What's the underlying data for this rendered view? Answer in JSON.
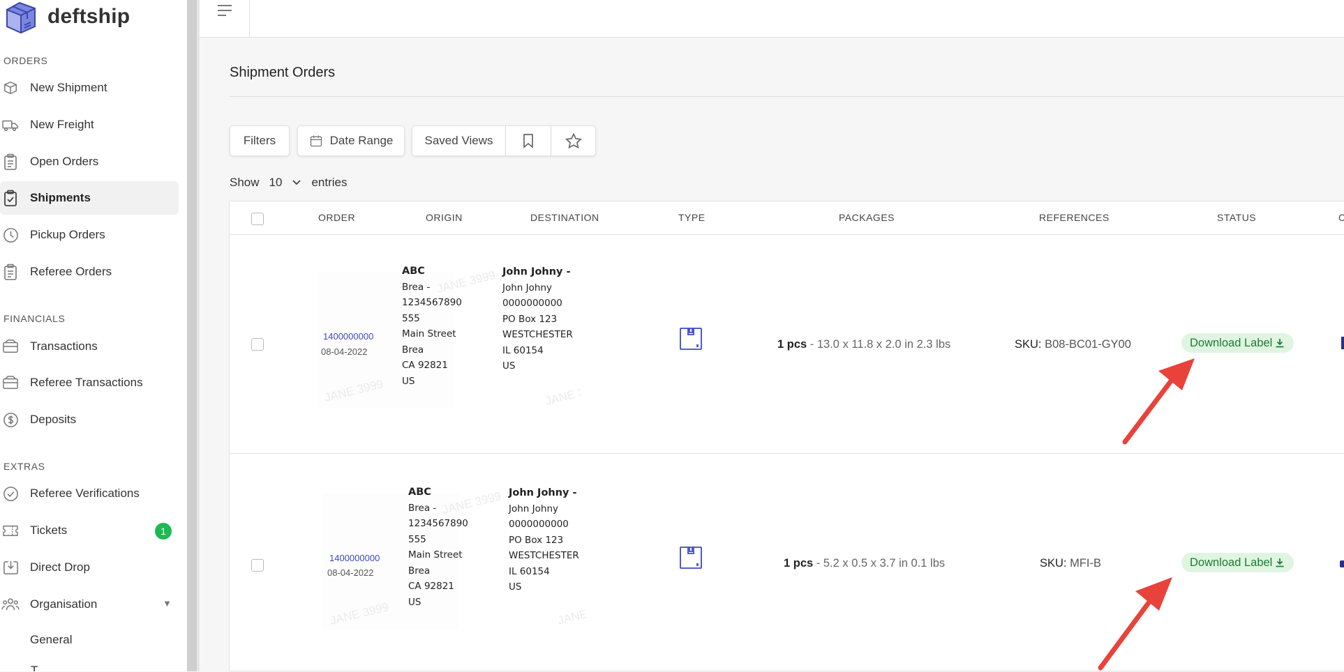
{
  "brand": {
    "name": "deftship"
  },
  "sidebar": {
    "sections": {
      "orders": "ORDERS",
      "financials": "FINANCIALS",
      "extras": "EXTRAS"
    },
    "items": [
      {
        "label": "New Shipment",
        "icon": "box-icon"
      },
      {
        "label": "New Freight",
        "icon": "truck-icon"
      },
      {
        "label": "Open Orders",
        "icon": "clipboard-icon"
      },
      {
        "label": "Shipments",
        "icon": "clipboard-check-icon",
        "active": true
      },
      {
        "label": "Pickup Orders",
        "icon": "clock-icon"
      },
      {
        "label": "Referee Orders",
        "icon": "clipboard-icon"
      },
      {
        "label": "Transactions",
        "icon": "wallet-icon"
      },
      {
        "label": "Referee Transactions",
        "icon": "wallet-icon"
      },
      {
        "label": "Deposits",
        "icon": "dollar-circle-icon"
      },
      {
        "label": "Referee Verifications",
        "icon": "check-circle-icon"
      },
      {
        "label": "Tickets",
        "icon": "ticket-icon",
        "badge": "1"
      },
      {
        "label": "Direct Drop",
        "icon": "download-box-icon"
      },
      {
        "label": "Organisation",
        "icon": "users-icon",
        "caret": "▼"
      },
      {
        "label": "General"
      }
    ]
  },
  "page": {
    "title": "Shipment Orders"
  },
  "toolbar": {
    "filters": "Filters",
    "date_range": "Date Range",
    "saved_views": "Saved Views"
  },
  "entries": {
    "show": "Show",
    "count": "10",
    "suffix": "entries"
  },
  "table": {
    "columns": [
      "ORDER",
      "ORIGIN",
      "DESTINATION",
      "TYPE",
      "PACKAGES",
      "REFERENCES",
      "STATUS",
      "C"
    ],
    "rows": [
      {
        "order_id": "1400000000",
        "date": "08-04-2022",
        "origin": [
          "ABC",
          "Brea -",
          "1234567890",
          "555",
          "Main Street",
          "Brea",
          "CA 92821",
          "US"
        ],
        "destination": [
          "John Johny -",
          "John Johny",
          "0000000000",
          "PO Box 123",
          "WESTCHESTER",
          "IL 60154",
          "US"
        ],
        "watermark": "JANE 3999",
        "packages_pcs": "1 pcs",
        "packages_dims": " - 13.0 x 11.8 x 2.0 in   2.3 lbs",
        "ref_label": "SKU:",
        "ref_value": " B08-BC01-GY00",
        "status": "Download Label"
      },
      {
        "order_id": "1400000000",
        "date": "08-04-2022",
        "origin": [
          "ABC",
          "Brea -",
          "1234567890",
          "555",
          "Main Street",
          "Brea",
          "CA 92821",
          "US"
        ],
        "destination": [
          "John Johny -",
          "John Johny",
          "0000000000",
          "PO Box 123",
          "WESTCHESTER",
          "IL 60154",
          "US"
        ],
        "watermark": "JANE 3999",
        "packages_pcs": "1 pcs",
        "packages_dims": " - 5.2 x 0.5 x 3.7 in   0.1 lbs",
        "ref_label": "SKU:",
        "ref_value": " MFI-B",
        "status": "Download Label"
      }
    ]
  },
  "colors": {
    "accent": "#3a47c9",
    "status_bg": "#dff5e2",
    "status_text": "#1e7b34",
    "badge": "#1db954",
    "arrow": "#e8423a"
  }
}
